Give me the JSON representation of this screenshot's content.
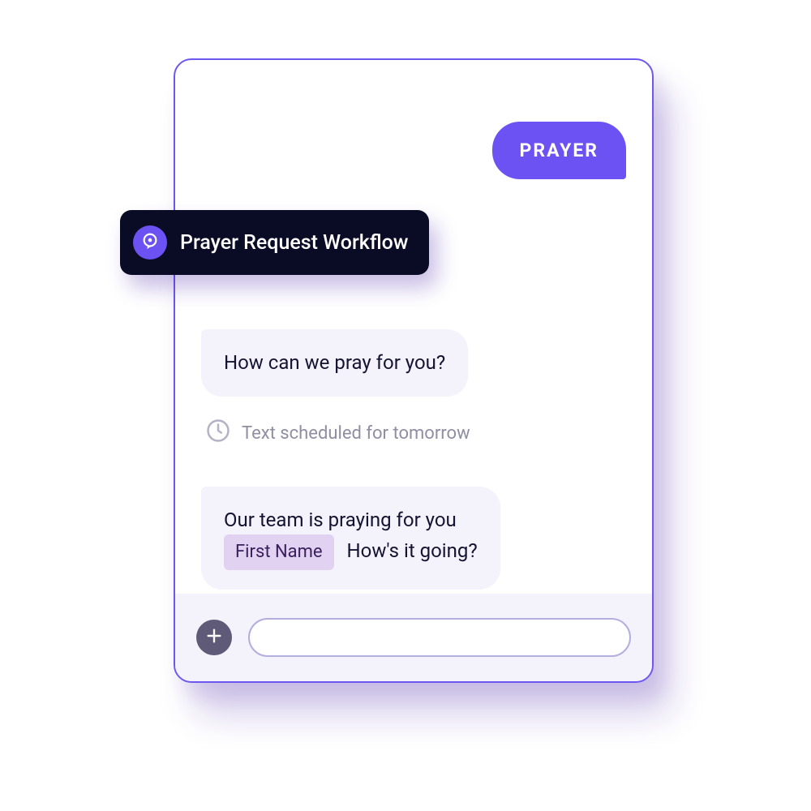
{
  "outgoing": {
    "label": "PRAYER"
  },
  "workflow": {
    "title": "Prayer Request Workflow"
  },
  "messages": {
    "m1": "How can we pray for you?",
    "m2_part1": "Our team is praying for you",
    "m2_token": "First Name",
    "m2_part2": "How's it going?"
  },
  "schedule": {
    "text": "Text scheduled for tomorrow"
  },
  "compose": {
    "placeholder": ""
  }
}
